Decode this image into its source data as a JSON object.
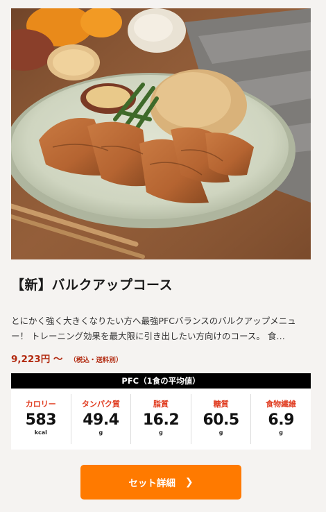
{
  "product": {
    "title": "【新】バルクアップコース",
    "description": "とにかく強く大きくなりたい方へ最強PFCバランスのバルクアップメニュー！ トレーニング効果を最大限に引き出したい方向けのコース。 食…",
    "price": "9,223円 〜",
    "price_note": "（税込・送料別）"
  },
  "pfc": {
    "header": "PFC（1食の平均値）",
    "items": [
      {
        "label": "カロリー",
        "value": "583",
        "unit": "kcal"
      },
      {
        "label": "タンパク質",
        "value": "49.4",
        "unit": "g"
      },
      {
        "label": "脂質",
        "value": "16.2",
        "unit": "g"
      },
      {
        "label": "糖質",
        "value": "60.5",
        "unit": "g"
      },
      {
        "label": "食物繊維",
        "value": "6.9",
        "unit": "g"
      }
    ]
  },
  "cta": {
    "label": "セット詳細",
    "icon": "chevron-right-icon"
  },
  "colors": {
    "accent": "#ff7a00",
    "price": "#b22a10",
    "nutrient_label": "#e03a1e"
  }
}
